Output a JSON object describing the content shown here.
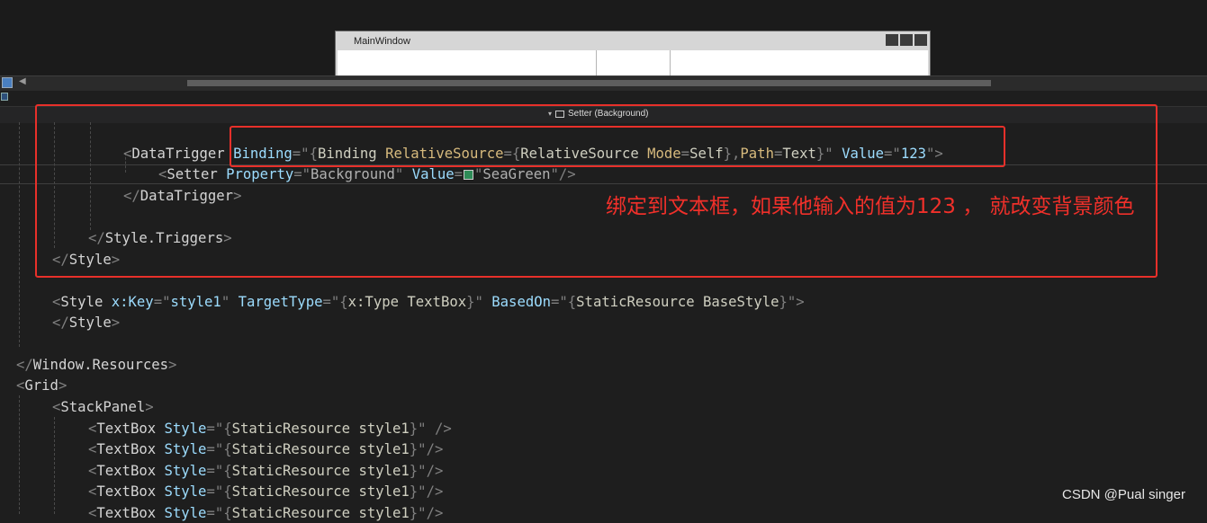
{
  "designer": {
    "window_title": "MainWindow"
  },
  "breadcrumb": {
    "label": "Setter (Background)"
  },
  "annotation": {
    "note": "绑定到文本框，如果他输入的值为123 ， 就改变背景颜色"
  },
  "watermark": "CSDN @Pual singer",
  "colors": {
    "annotation_red": "#e8302a",
    "seagreen_swatch": "#2e8b57",
    "editor_background": "#1e1e1e"
  },
  "code": {
    "l1": {
      "open": "<",
      "tag": "DataTrigger",
      "a1": "Binding",
      "eq1": "=\"",
      "b1": "{",
      "m1": "Binding",
      "sp1": " ",
      "p1": "RelativeSource",
      "eq2": "=",
      "b2": "{",
      "m2": "RelativeSource",
      "sp2": " ",
      "p2": "Mode",
      "eq3": "=",
      "v1": "Self",
      "b3": "},",
      "p3": "Path",
      "eq4": "=",
      "v2": "Text",
      "b4": "}\"",
      "a2": "Value",
      "eq5": "=\"",
      "v3": "123",
      "close": "\">"
    },
    "l2": {
      "open": "<",
      "tag": "Setter",
      "a1": "Property",
      "eq1": "=\"",
      "v1": "Background",
      "q1": "\"",
      "a2": "Value",
      "eq2": "=",
      "q2": "\"",
      "v2": "SeaGreen",
      "close": "\"/>"
    },
    "l3": {
      "open": "</",
      "tag": "DataTrigger",
      "close": ">"
    },
    "l4": {
      "open": "</",
      "tag": "Style.Triggers",
      "close": ">"
    },
    "l5": {
      "open": "</",
      "tag": "Style",
      "close": ">"
    },
    "l6": {
      "open": "<",
      "tag": "Style",
      "a1": "x:Key",
      "eq1": "=\"",
      "v1": "style1",
      "q1": "\"",
      "a2": "TargetType",
      "eq2": "=\"",
      "b1": "{",
      "m1": "x:Type",
      "sp1": " ",
      "v2": "TextBox",
      "b2": "}\"",
      "a3": "BasedOn",
      "eq3": "=\"",
      "b3": "{",
      "m2": "StaticResource",
      "sp2": " ",
      "v3": "BaseStyle",
      "b4": "}\"",
      "close": ">"
    },
    "l7": {
      "open": "</",
      "tag": "Style",
      "close": ">"
    },
    "l8": {
      "open": "</",
      "tag": "Window.Resources",
      "close": ">"
    },
    "l9": {
      "open": "<",
      "tag": "Grid",
      "close": ">"
    },
    "l10": {
      "open": "<",
      "tag": "StackPanel",
      "close": ">"
    },
    "tb": {
      "open": "<",
      "tag": "TextBox",
      "a1": "Style",
      "eq1": "=\"",
      "b1": "{",
      "m1": "StaticResource",
      "sp1": " ",
      "v1": "style1",
      "b2": "}\"",
      "close_sp": " />",
      "close": "/>"
    }
  }
}
